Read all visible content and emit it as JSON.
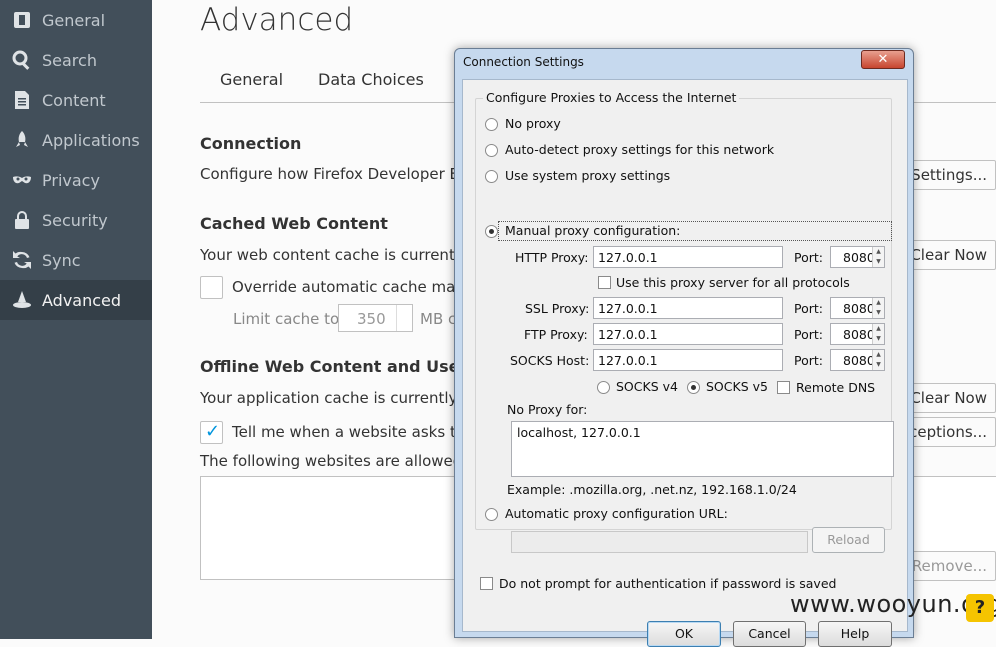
{
  "sidebar": {
    "items": [
      {
        "label": "General",
        "icon": "general-icon"
      },
      {
        "label": "Search",
        "icon": "search-icon"
      },
      {
        "label": "Content",
        "icon": "content-icon"
      },
      {
        "label": "Applications",
        "icon": "rocket-icon"
      },
      {
        "label": "Privacy",
        "icon": "mask-icon"
      },
      {
        "label": "Security",
        "icon": "security-icon"
      },
      {
        "label": "Sync",
        "icon": "sync-icon"
      },
      {
        "label": "Advanced",
        "icon": "advanced-icon",
        "active": true
      }
    ]
  },
  "main": {
    "title": "Advanced",
    "tabs": [
      "General",
      "Data Choices"
    ],
    "connection": {
      "heading": "Connection",
      "text": "Configure how Firefox Developer Ec",
      "button": "Settings..."
    },
    "cache": {
      "heading": "Cached Web Content",
      "text": "Your web content cache is currently",
      "button": "Clear Now",
      "override_label": "Override automatic cache mana",
      "limit_label": "Limit cache to",
      "limit_value": "350",
      "limit_unit": "MB c"
    },
    "offline": {
      "heading": "Offline Web Content and User D",
      "text": "Your application cache is currently u",
      "button": "Clear Now",
      "tell_label": "Tell me when a website asks to",
      "exceptions_button": "ceptions...",
      "allowed_text": "The following websites are allowed",
      "remove_button": "Remove..."
    }
  },
  "dialog": {
    "title": "Connection Settings",
    "close": "✕",
    "group_label": "Configure Proxies to Access the Internet",
    "options": {
      "no_proxy": "No proxy",
      "auto_detect": "Auto-detect proxy settings for this network",
      "system": "Use system proxy settings",
      "manual": "Manual proxy configuration:",
      "auto_url": "Automatic proxy configuration URL:"
    },
    "http": {
      "label": "HTTP Proxy:",
      "value": "127.0.0.1",
      "port_label": "Port:",
      "port": "8080"
    },
    "use_all_label": "Use this proxy server for all protocols",
    "ssl": {
      "label": "SSL Proxy:",
      "value": "127.0.0.1",
      "port_label": "Port:",
      "port": "8080"
    },
    "ftp": {
      "label": "FTP Proxy:",
      "value": "127.0.0.1",
      "port_label": "Port:",
      "port": "8080"
    },
    "socks": {
      "label": "SOCKS Host:",
      "value": "127.0.0.1",
      "port_label": "Port:",
      "port": "8080"
    },
    "socks_v4": "SOCKS v4",
    "socks_v5": "SOCKS v5",
    "remote_dns": "Remote DNS",
    "no_proxy_label": "No Proxy for:",
    "no_proxy_value": "localhost, 127.0.0.1",
    "example": "Example: .mozilla.org, .net.nz, 192.168.1.0/24",
    "reload": "Reload",
    "no_prompt": "Do not prompt for authentication if password is saved",
    "ok": "OK",
    "cancel": "Cancel",
    "help": "Help"
  },
  "watermark": "www.wooyun.org",
  "help_badge": "?"
}
